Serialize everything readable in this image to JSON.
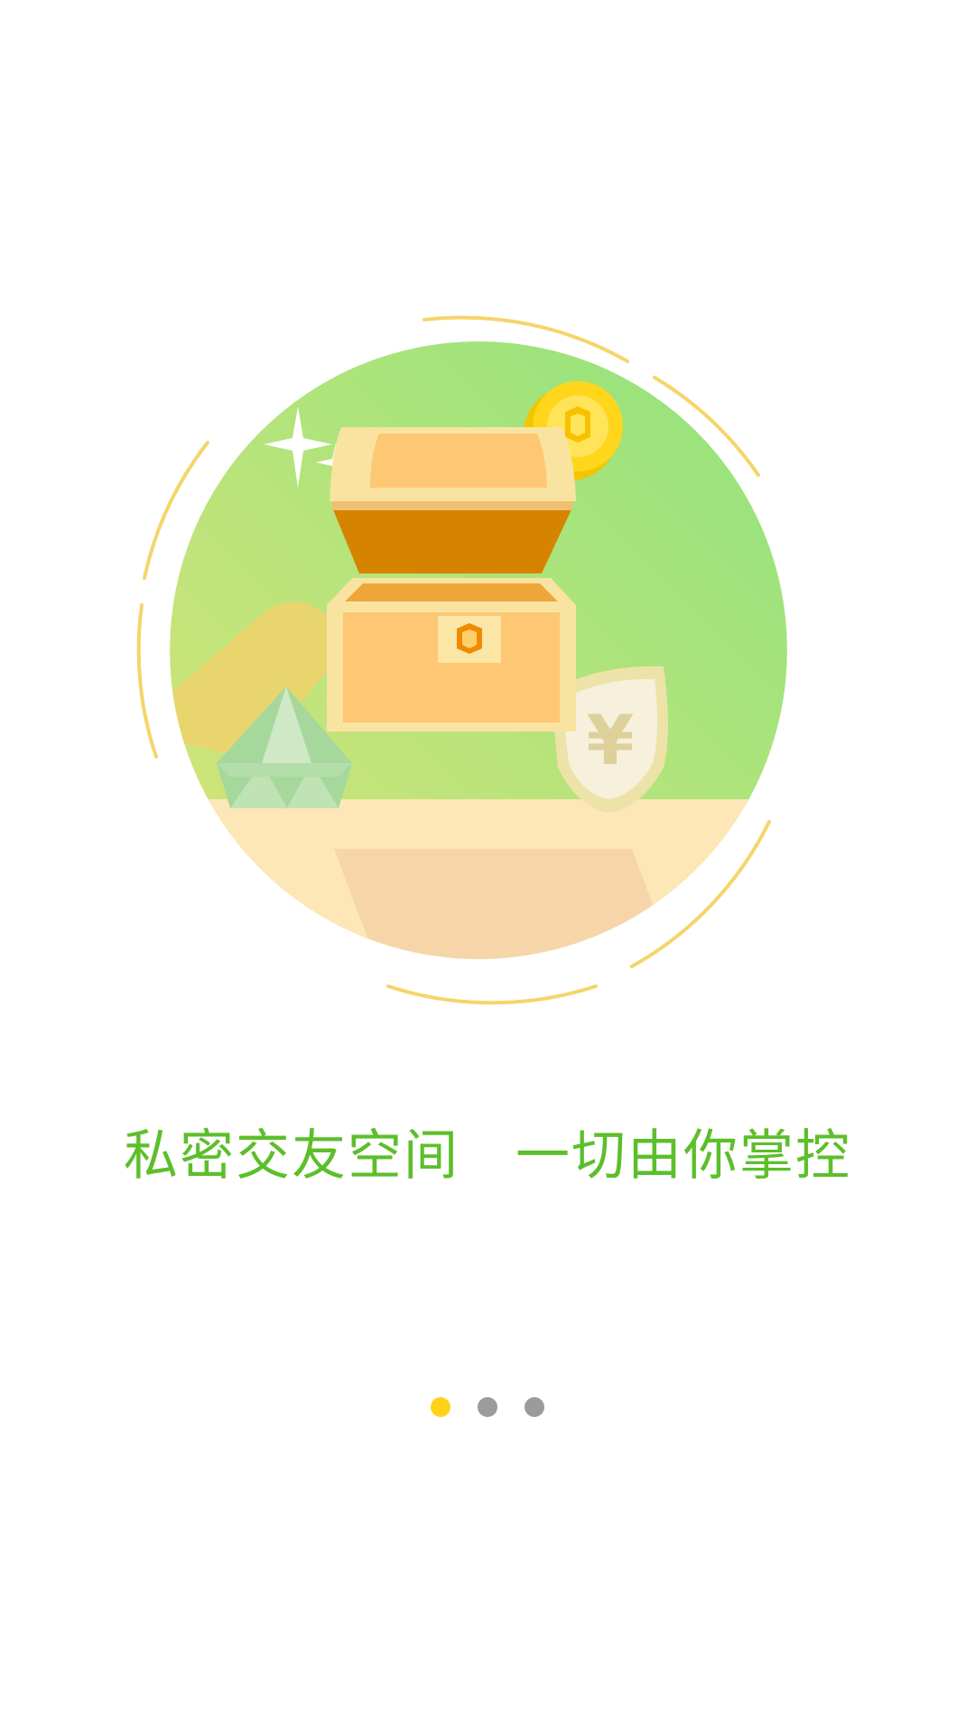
{
  "onboarding": {
    "tagline": "私密交友空间　一切由你掌控",
    "page_count": 3,
    "current_page": 1
  },
  "illustration": {
    "name": "treasure-chest-illustration",
    "coin_symbol": "¥"
  },
  "colors": {
    "tagline": "#5cbf2a",
    "dot_active": "#ffd21a",
    "dot_inactive": "#9b9b9b",
    "circle_green": "#a6e57a",
    "ring_yellow": "#f5d56a"
  }
}
